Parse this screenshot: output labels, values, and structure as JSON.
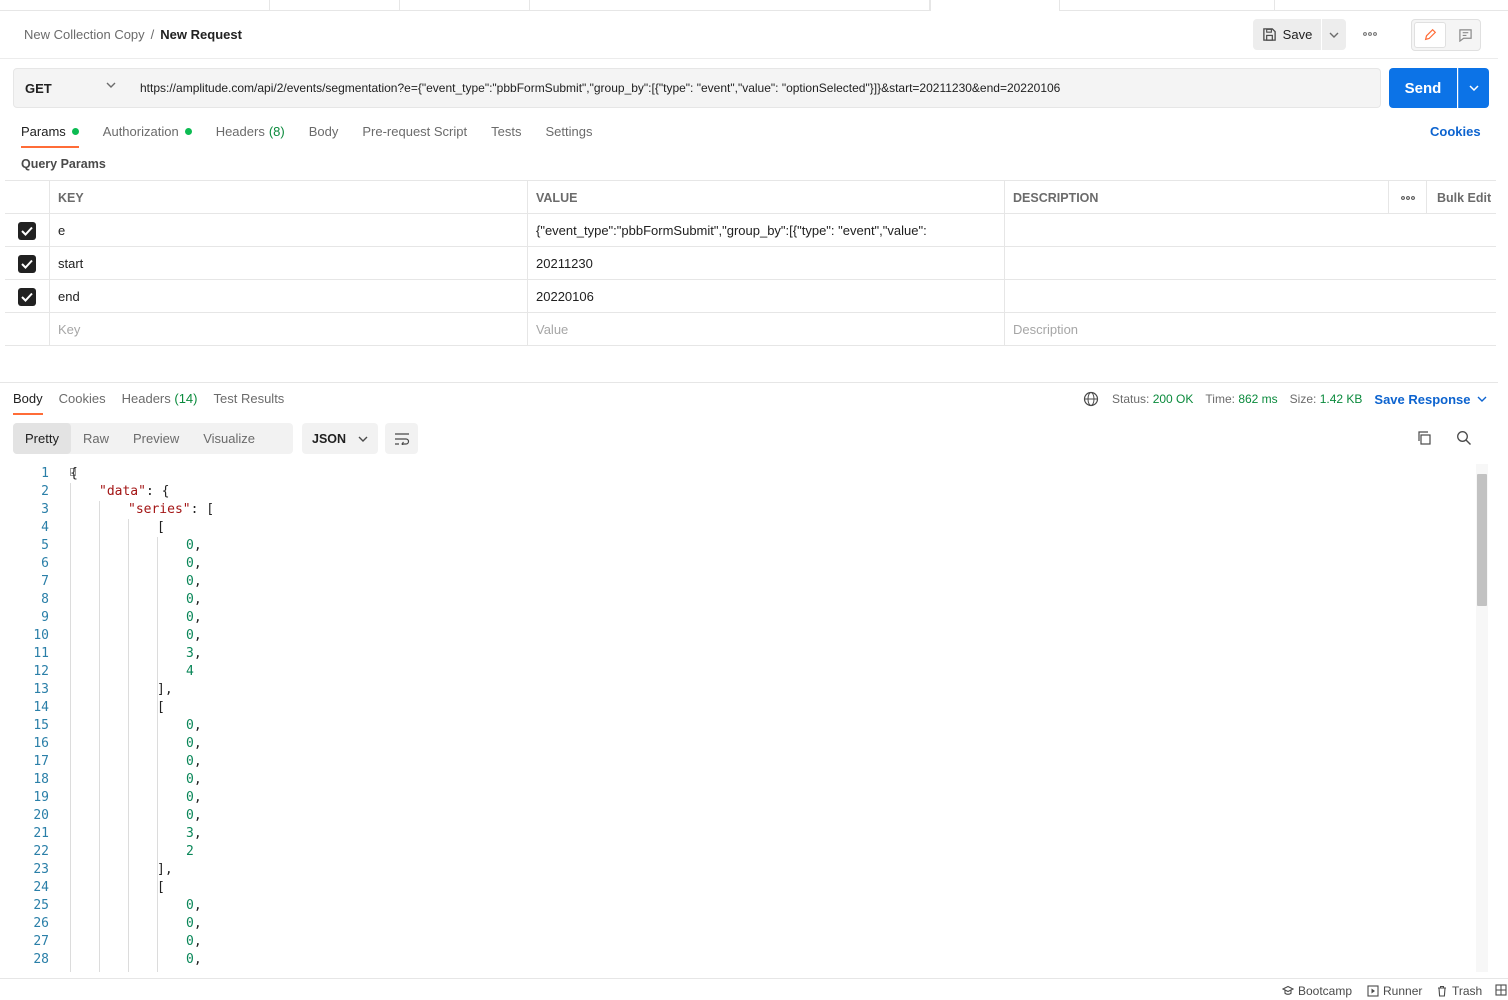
{
  "breadcrumb": {
    "parent": "New Collection Copy",
    "separator": "/",
    "current": "New Request"
  },
  "toolbar": {
    "save_label": "Save"
  },
  "request": {
    "method": "GET",
    "url": "https://amplitude.com/api/2/events/segmentation?e={\"event_type\":\"pbbFormSubmit\",\"group_by\":[{\"type\": \"event\",\"value\": \"optionSelected\"}]}&start=20211230&end=20220106",
    "send_label": "Send"
  },
  "request_tabs": [
    {
      "label": "Params",
      "dot": true,
      "count": ""
    },
    {
      "label": "Authorization",
      "dot": true,
      "count": ""
    },
    {
      "label": "Headers",
      "dot": false,
      "count": "(8)"
    },
    {
      "label": "Body",
      "dot": false,
      "count": ""
    },
    {
      "label": "Pre-request Script",
      "dot": false,
      "count": ""
    },
    {
      "label": "Tests",
      "dot": false,
      "count": ""
    },
    {
      "label": "Settings",
      "dot": false,
      "count": ""
    }
  ],
  "cookies_link": "Cookies",
  "query_params": {
    "title": "Query Params",
    "headers": {
      "key": "KEY",
      "value": "VALUE",
      "description": "DESCRIPTION",
      "bulk_edit": "Bulk Edit"
    },
    "rows": [
      {
        "key": "e",
        "value": "{\"event_type\":\"pbbFormSubmit\",\"group_by\":[{\"type\": \"event\",\"value\":",
        "description": ""
      },
      {
        "key": "start",
        "value": "20211230",
        "description": ""
      },
      {
        "key": "end",
        "value": "20220106",
        "description": ""
      }
    ],
    "placeholders": {
      "key": "Key",
      "value": "Value",
      "description": "Description"
    }
  },
  "response": {
    "tabs": [
      {
        "label": "Body",
        "count": ""
      },
      {
        "label": "Cookies",
        "count": ""
      },
      {
        "label": "Headers",
        "count": "(14)"
      },
      {
        "label": "Test Results",
        "count": ""
      }
    ],
    "status_label": "Status:",
    "status_value": "200 OK",
    "time_label": "Time:",
    "time_value": "862 ms",
    "size_label": "Size:",
    "size_value": "1.42 KB",
    "save_response": "Save Response",
    "views": [
      "Pretty",
      "Raw",
      "Preview",
      "Visualize"
    ],
    "format": "JSON"
  },
  "code_lines": [
    {
      "n": "1",
      "indent": 0,
      "parts": [
        [
          "p",
          "{"
        ]
      ]
    },
    {
      "n": "2",
      "indent": 1,
      "parts": [
        [
          "k",
          "\"data\""
        ],
        [
          "p",
          ": {"
        ]
      ]
    },
    {
      "n": "3",
      "indent": 2,
      "parts": [
        [
          "k",
          "\"series\""
        ],
        [
          "p",
          ": ["
        ]
      ]
    },
    {
      "n": "4",
      "indent": 3,
      "parts": [
        [
          "p",
          "["
        ]
      ]
    },
    {
      "n": "5",
      "indent": 4,
      "parts": [
        [
          "n",
          "0"
        ],
        [
          "p",
          ","
        ]
      ]
    },
    {
      "n": "6",
      "indent": 4,
      "parts": [
        [
          "n",
          "0"
        ],
        [
          "p",
          ","
        ]
      ]
    },
    {
      "n": "7",
      "indent": 4,
      "parts": [
        [
          "n",
          "0"
        ],
        [
          "p",
          ","
        ]
      ]
    },
    {
      "n": "8",
      "indent": 4,
      "parts": [
        [
          "n",
          "0"
        ],
        [
          "p",
          ","
        ]
      ]
    },
    {
      "n": "9",
      "indent": 4,
      "parts": [
        [
          "n",
          "0"
        ],
        [
          "p",
          ","
        ]
      ]
    },
    {
      "n": "10",
      "indent": 4,
      "parts": [
        [
          "n",
          "0"
        ],
        [
          "p",
          ","
        ]
      ]
    },
    {
      "n": "11",
      "indent": 4,
      "parts": [
        [
          "n",
          "3"
        ],
        [
          "p",
          ","
        ]
      ]
    },
    {
      "n": "12",
      "indent": 4,
      "parts": [
        [
          "n",
          "4"
        ]
      ]
    },
    {
      "n": "13",
      "indent": 3,
      "parts": [
        [
          "p",
          "],"
        ]
      ]
    },
    {
      "n": "14",
      "indent": 3,
      "parts": [
        [
          "p",
          "["
        ]
      ]
    },
    {
      "n": "15",
      "indent": 4,
      "parts": [
        [
          "n",
          "0"
        ],
        [
          "p",
          ","
        ]
      ]
    },
    {
      "n": "16",
      "indent": 4,
      "parts": [
        [
          "n",
          "0"
        ],
        [
          "p",
          ","
        ]
      ]
    },
    {
      "n": "17",
      "indent": 4,
      "parts": [
        [
          "n",
          "0"
        ],
        [
          "p",
          ","
        ]
      ]
    },
    {
      "n": "18",
      "indent": 4,
      "parts": [
        [
          "n",
          "0"
        ],
        [
          "p",
          ","
        ]
      ]
    },
    {
      "n": "19",
      "indent": 4,
      "parts": [
        [
          "n",
          "0"
        ],
        [
          "p",
          ","
        ]
      ]
    },
    {
      "n": "20",
      "indent": 4,
      "parts": [
        [
          "n",
          "0"
        ],
        [
          "p",
          ","
        ]
      ]
    },
    {
      "n": "21",
      "indent": 4,
      "parts": [
        [
          "n",
          "3"
        ],
        [
          "p",
          ","
        ]
      ]
    },
    {
      "n": "22",
      "indent": 4,
      "parts": [
        [
          "n",
          "2"
        ]
      ]
    },
    {
      "n": "23",
      "indent": 3,
      "parts": [
        [
          "p",
          "],"
        ]
      ]
    },
    {
      "n": "24",
      "indent": 3,
      "parts": [
        [
          "p",
          "["
        ]
      ]
    },
    {
      "n": "25",
      "indent": 4,
      "parts": [
        [
          "n",
          "0"
        ],
        [
          "p",
          ","
        ]
      ]
    },
    {
      "n": "26",
      "indent": 4,
      "parts": [
        [
          "n",
          "0"
        ],
        [
          "p",
          ","
        ]
      ]
    },
    {
      "n": "27",
      "indent": 4,
      "parts": [
        [
          "n",
          "0"
        ],
        [
          "p",
          ","
        ]
      ]
    },
    {
      "n": "28",
      "indent": 4,
      "parts": [
        [
          "n",
          "0"
        ],
        [
          "p",
          ","
        ]
      ]
    }
  ],
  "footer": {
    "bootcamp": "Bootcamp",
    "runner": "Runner",
    "trash": "Trash"
  },
  "colors": {
    "accent": "#ff6c37",
    "primary": "#0c73e7",
    "success": "#0cbb52",
    "json_key": "#a31515",
    "json_number": "#098658"
  },
  "icons": [
    "save-icon",
    "chevron-down-icon",
    "more-icon",
    "edit-icon",
    "comment-icon",
    "checkbox-checked-icon",
    "globe-icon",
    "wrap-lines-icon",
    "copy-icon",
    "search-icon",
    "bootcamp-icon",
    "runner-icon",
    "trash-icon",
    "layout-icon"
  ]
}
